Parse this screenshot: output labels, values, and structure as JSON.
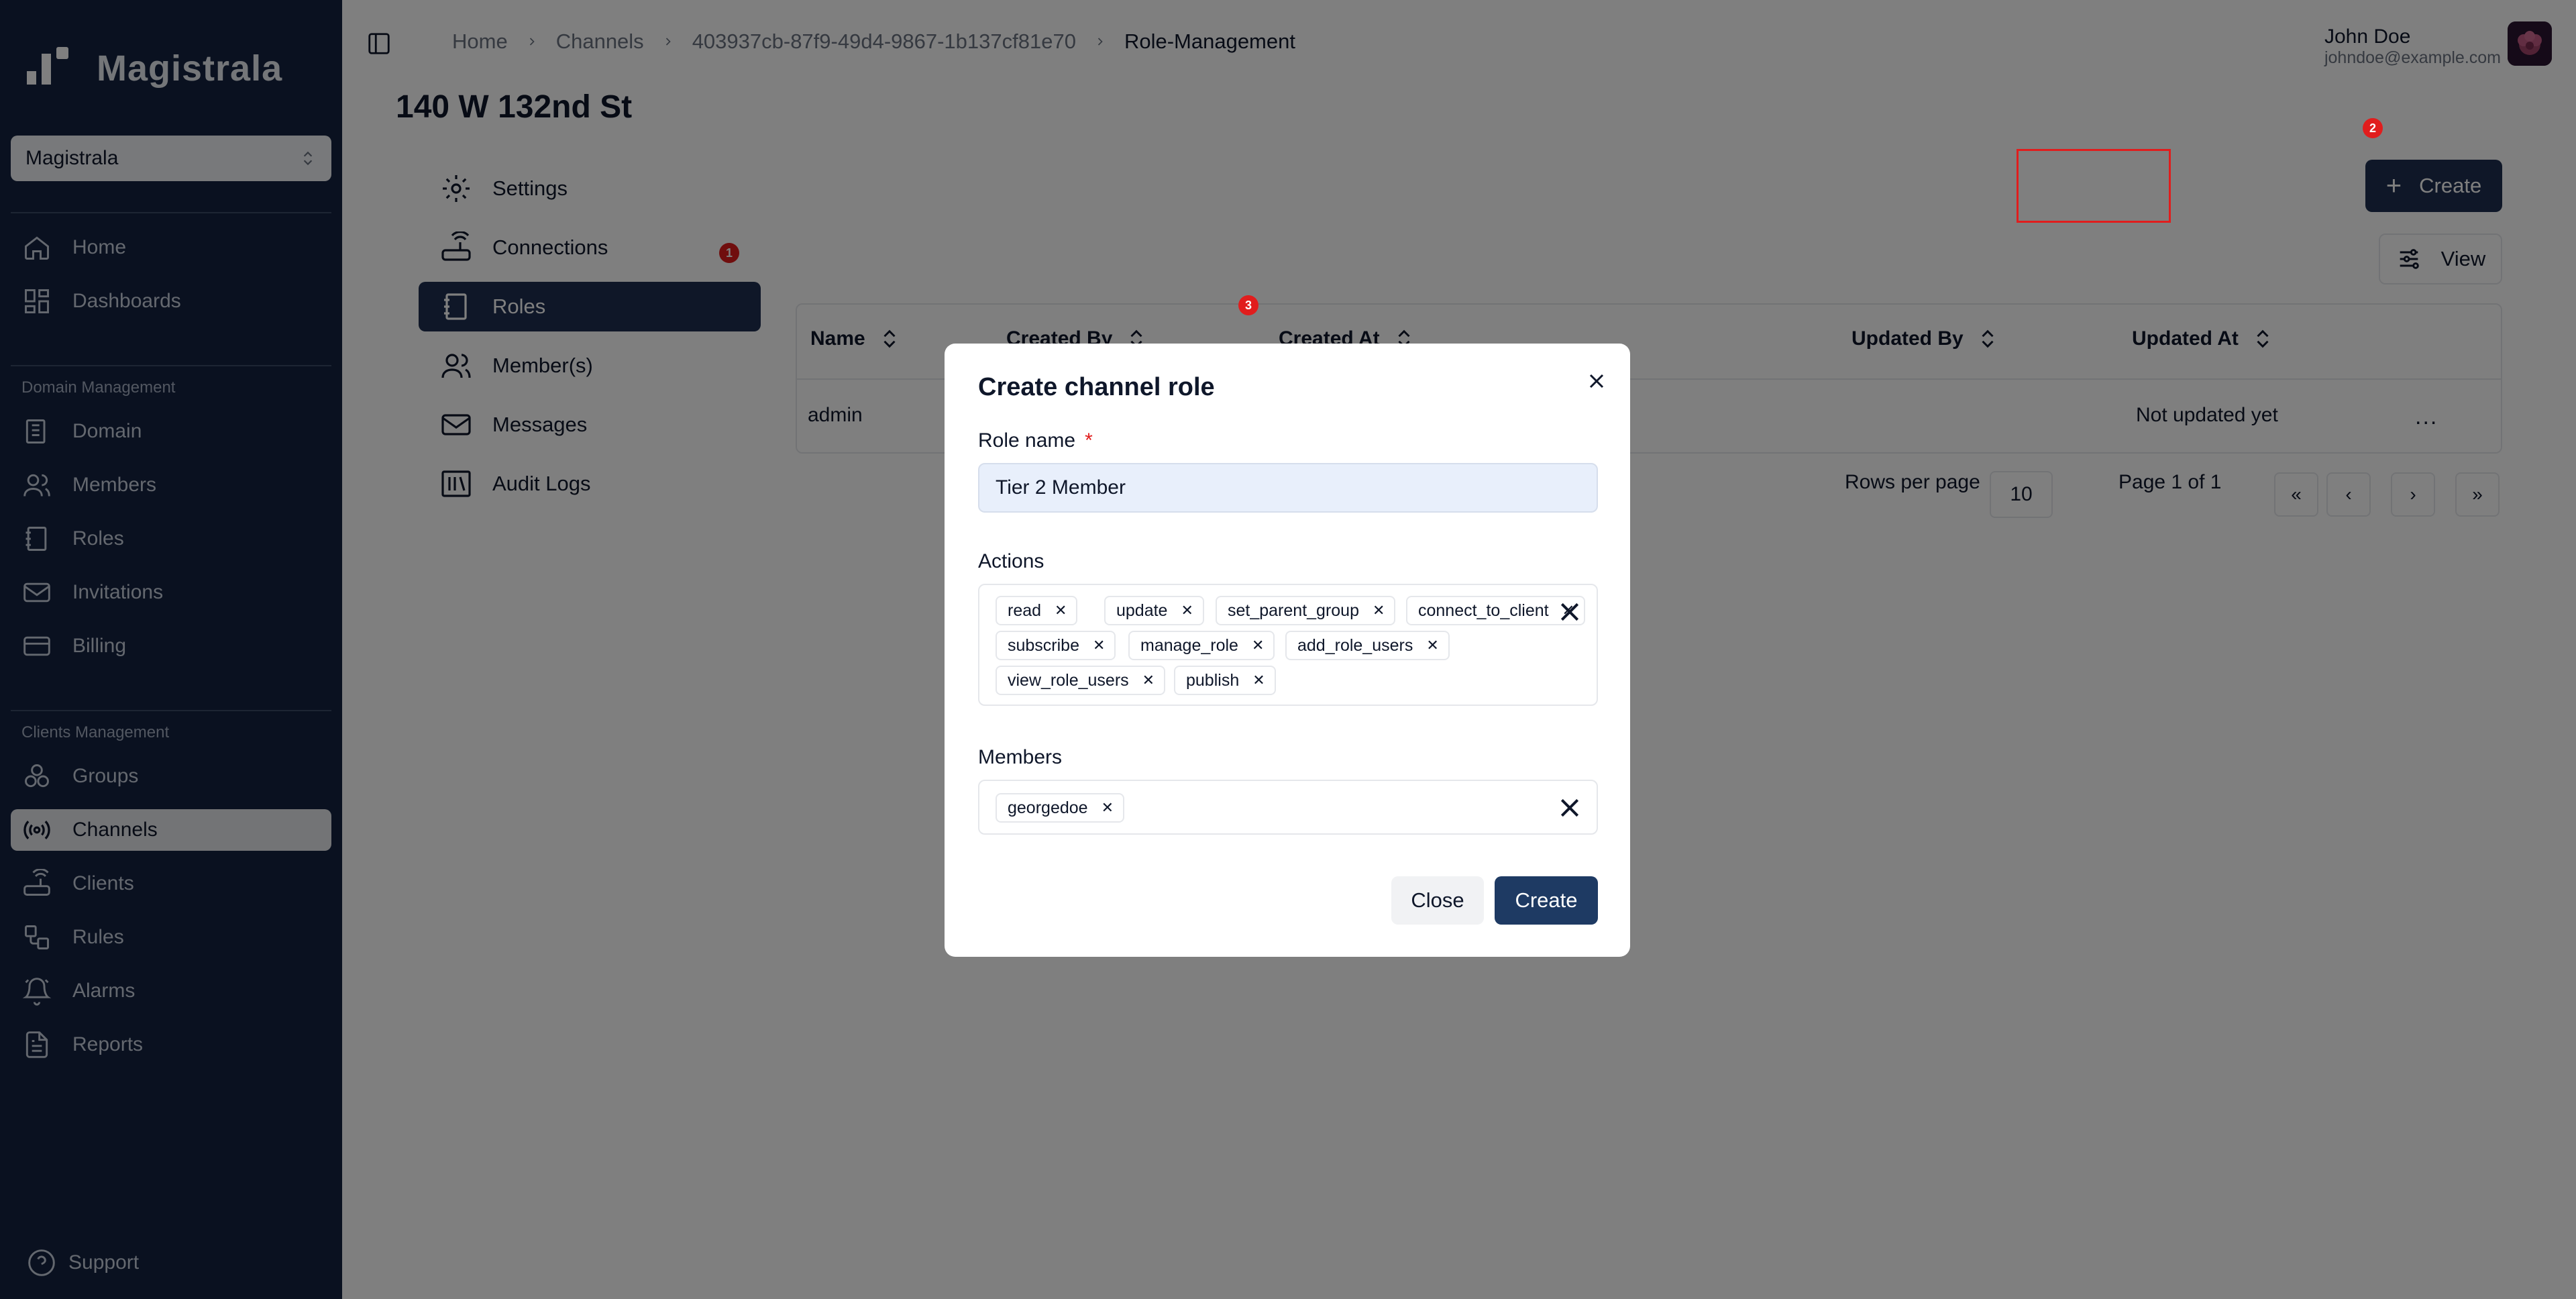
{
  "brand": {
    "name": "Magistrala"
  },
  "sidebar": {
    "domain_select": "Magistrala",
    "main_items": [
      {
        "label": "Home",
        "icon": "home-icon"
      },
      {
        "label": "Dashboards",
        "icon": "dashboard-icon"
      }
    ],
    "domain_section_title": "Domain Management",
    "domain_items": [
      {
        "label": "Domain",
        "icon": "domain-icon"
      },
      {
        "label": "Members",
        "icon": "members-icon"
      },
      {
        "label": "Roles",
        "icon": "roles-icon"
      },
      {
        "label": "Invitations",
        "icon": "mail-icon"
      },
      {
        "label": "Billing",
        "icon": "credit-card-icon"
      }
    ],
    "clients_section_title": "Clients Management",
    "clients_items": [
      {
        "label": "Groups",
        "icon": "groups-icon"
      },
      {
        "label": "Channels",
        "icon": "radio-icon",
        "active": true
      },
      {
        "label": "Clients",
        "icon": "router-icon"
      },
      {
        "label": "Rules",
        "icon": "workflow-icon"
      },
      {
        "label": "Alarms",
        "icon": "bell-icon"
      },
      {
        "label": "Reports",
        "icon": "file-text-icon"
      }
    ],
    "support_label": "Support"
  },
  "breadcrumb": [
    "Home",
    "Channels",
    "403937cb-87f9-49d4-9867-1b137cf81e70",
    "Role-Management"
  ],
  "user": {
    "name": "John Doe",
    "email": "johndoe@example.com"
  },
  "page": {
    "title": "140 W 132nd St",
    "subnav": [
      {
        "label": "Settings",
        "icon": "settings-icon"
      },
      {
        "label": "Connections",
        "icon": "router-icon"
      },
      {
        "label": "Roles",
        "icon": "notebook-icon",
        "active": true
      },
      {
        "label": "Member(s)",
        "icon": "users-icon"
      },
      {
        "label": "Messages",
        "icon": "mail-icon"
      },
      {
        "label": "Audit Logs",
        "icon": "library-icon"
      }
    ],
    "create_button": "Create",
    "view_button": "View",
    "badges": [
      "1",
      "2",
      "3"
    ]
  },
  "table": {
    "columns": [
      "Name",
      "Created By",
      "Created At",
      "Updated By",
      "Updated At"
    ],
    "rows": [
      {
        "name": "admin",
        "created_by": "",
        "created_at": "",
        "updated_by": "",
        "updated_at": "Not updated yet",
        "actions": "..."
      }
    ],
    "rows_per_page_label": "Rows per page",
    "rows_per_page_value": "10",
    "page_info": "Page 1 of 1",
    "pager_buttons": [
      "«",
      "‹",
      "›",
      "»"
    ]
  },
  "dialog": {
    "title": "Create channel role",
    "role_name_label": "Role name",
    "required_mark": "*",
    "role_name_value": "Tier 2 Member",
    "actions_label": "Actions",
    "actions": [
      "read",
      "update",
      "set_parent_group",
      "connect_to_client",
      "subscribe",
      "manage_role",
      "add_role_users",
      "view_role_users",
      "publish"
    ],
    "members_label": "Members",
    "members": [
      "georgedoe"
    ],
    "close_button": "Close",
    "create_button": "Create"
  },
  "colors": {
    "sidebar_bg": "#142340",
    "primary": "#1e2f50",
    "badge": "#e11d1d",
    "input_bg": "#e8effb"
  }
}
